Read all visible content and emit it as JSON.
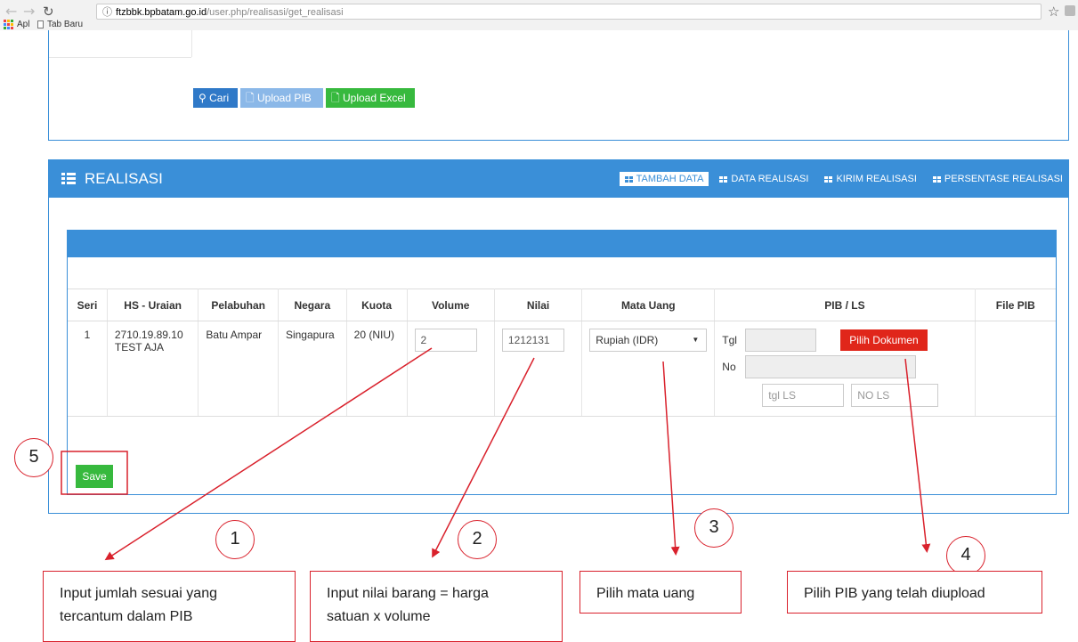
{
  "browser": {
    "url_host": "ftzbbk.bpbatam.go.id",
    "url_path": "/user.php/realisasi/get_realisasi",
    "bookmarks": [
      "Apl",
      "Tab Baru"
    ]
  },
  "toolbar": {
    "cari_label": "Cari",
    "upload_pib_label": "Upload PIB",
    "upload_excel_label": "Upload Excel"
  },
  "realisasi": {
    "title": "REALISASI",
    "tabs": [
      "TAMBAH DATA",
      "DATA REALISASI",
      "KIRIM REALISASI",
      "PERSENTASE REALISASI"
    ],
    "active_tab": "TAMBAH DATA"
  },
  "table": {
    "headers": [
      "Seri",
      "HS - Uraian",
      "Pelabuhan",
      "Negara",
      "Kuota",
      "Volume",
      "Nilai",
      "Mata Uang",
      "PIB / LS",
      "File PIB"
    ],
    "row": {
      "seri": "1",
      "hs_code": "2710.19.89.10",
      "uraian": "TEST AJA",
      "pelabuhan": "Batu Ampar",
      "negara": "Singapura",
      "kuota": "20 (NIU)",
      "volume": "2",
      "nilai": "1212131",
      "mata_uang": "Rupiah (IDR)",
      "tgl_label": "Tgl",
      "no_label": "No",
      "pilih_dokumen_label": "Pilih Dokumen",
      "tgl_ls_placeholder": "tgl LS",
      "no_ls_placeholder": "NO LS"
    }
  },
  "save_label": "Save",
  "annotations": [
    {
      "number": "1",
      "line1": "Input jumlah sesuai yang",
      "line2": "tercantum dalam PIB"
    },
    {
      "number": "2",
      "line1": "Input nilai barang = harga",
      "line2": "satuan x volume"
    },
    {
      "number": "3",
      "line1": "Pilih mata uang",
      "line2": ""
    },
    {
      "number": "4",
      "line1": "Pilih PIB yang telah diupload",
      "line2": ""
    },
    {
      "number": "5"
    }
  ],
  "colors": {
    "primary": "#3a8fd8",
    "success": "#37b93e",
    "danger": "#e0261a",
    "annotation": "#d9212c"
  }
}
